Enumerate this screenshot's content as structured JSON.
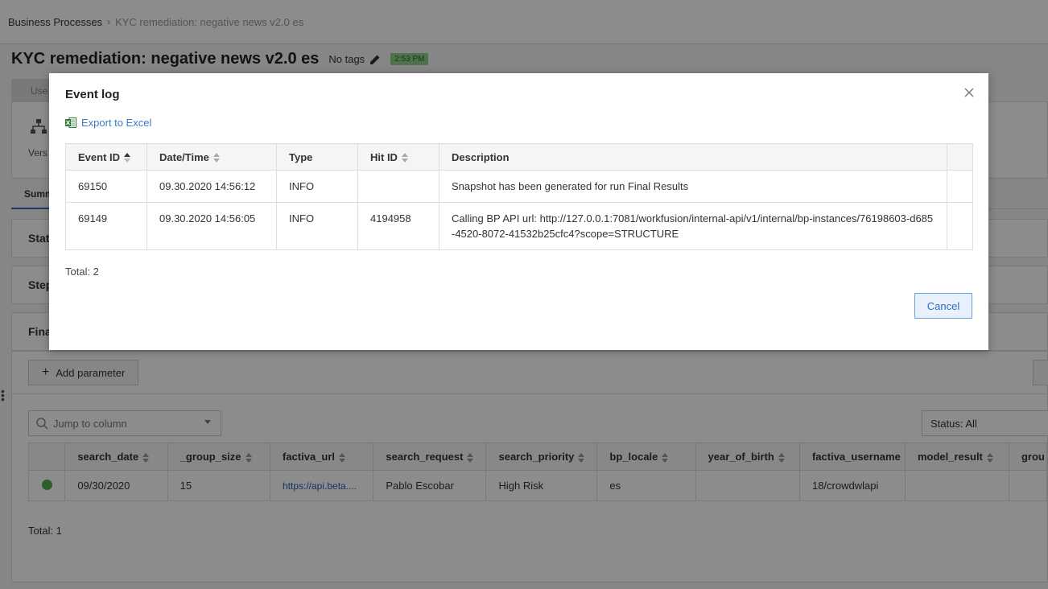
{
  "breadcrumb": {
    "root": "Business Processes",
    "current": "KYC remediation: negative news v2.0 es"
  },
  "header": {
    "title": "KYC remediation: negative news v2.0 es",
    "tags_label": "No tags",
    "time_badge": "2:53 PM",
    "time_badge_color": "#8fd08b"
  },
  "background": {
    "tab_stub": "Use",
    "version_stub": "Vers",
    "active_tab_stub": "Summ",
    "sections": [
      "Stat",
      "Step",
      "Fina"
    ],
    "add_parameter_label": "Add parameter",
    "jump_placeholder": "Jump to column",
    "status_filter": "Status: All",
    "table": {
      "columns": [
        "search_date",
        "_group_size",
        "factiva_url",
        "search_request",
        "search_priority",
        "bp_locale",
        "year_of_birth",
        "factiva_username",
        "model_result",
        "grou"
      ],
      "row": [
        "09/30/2020",
        "15",
        "https://api.beta....",
        "Pablo Escobar",
        "High Risk",
        "es",
        "",
        "18/crowdwlapi",
        "",
        ""
      ],
      "status_color": "#4caf50"
    },
    "total": "Total: 1"
  },
  "modal": {
    "title": "Event log",
    "export_label": "Export to Excel",
    "columns": [
      "Event ID",
      "Date/Time",
      "Type",
      "Hit ID",
      "Description"
    ],
    "rows": [
      {
        "event_id": "69150",
        "datetime": "09.30.2020 14:56:12",
        "type": "INFO",
        "hit_id": "",
        "description": "Snapshot has been generated for run Final Results"
      },
      {
        "event_id": "69149",
        "datetime": "09.30.2020 14:56:05",
        "type": "INFO",
        "hit_id": "4194958",
        "description": "Calling BP API url: http://127.0.0.1:7081/workfusion/internal-api/v1/internal/bp-instances/76198603-d685-4520-8072-41532b25cfc4?scope=STRUCTURE"
      }
    ],
    "total": "Total: 2",
    "cancel_label": "Cancel",
    "accent_color": "#2f6bc3"
  }
}
